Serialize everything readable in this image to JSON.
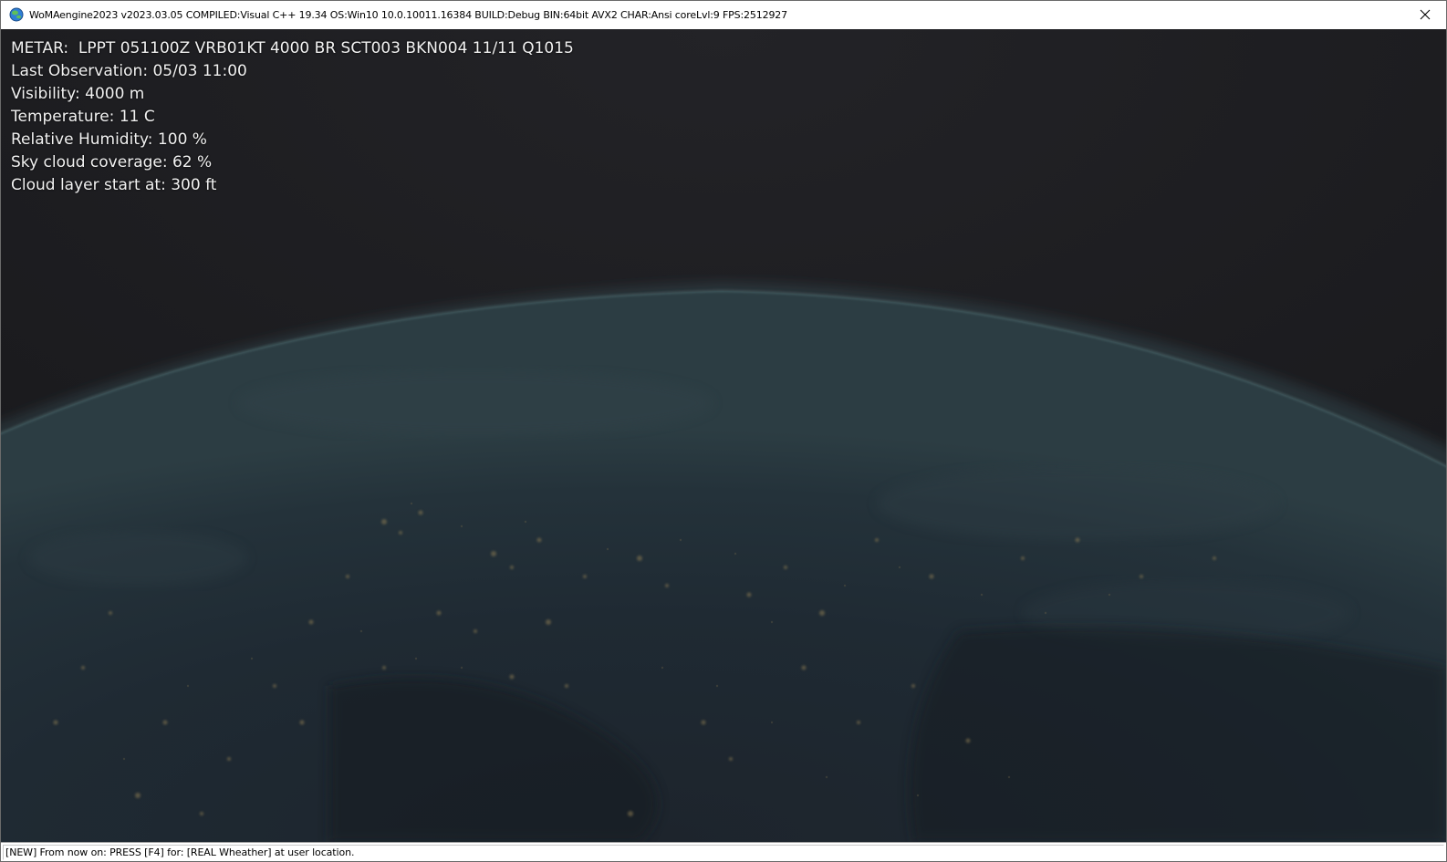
{
  "window": {
    "title": "WoMAengine2023 v2023.03.05 COMPILED:Visual C++ 19.34 OS:Win10 10.0.10011.16384 BUILD:Debug BIN:64bit AVX2 CHAR:Ansi coreLvl:9 FPS:2512927",
    "icon": "globe-icon",
    "close_icon": "close-icon"
  },
  "hud": {
    "metar": "METAR:  LPPT 051100Z VRB01KT 4000 BR SCT003 BKN004 11/11 Q1015",
    "last_observation": "Last Observation: 05/03 11:00",
    "visibility": "Visibility: 4000 m",
    "temperature": "Temperature: 11 C",
    "humidity": "Relative Humidity: 100 %",
    "cloud_coverage": "Sky cloud coverage: 62 %",
    "cloud_layer": "Cloud layer start at: 300 ft"
  },
  "statusbar": {
    "text": "[NEW] From now on: PRESS [F4] for: [REAL Wheather] at user location."
  },
  "colors": {
    "space": "#1c1c1f",
    "earth_dark": "#1a222b",
    "atmosphere": "#3d5a64",
    "city_lights": "#8a7a52",
    "hud_text": "#f2f2f2"
  }
}
